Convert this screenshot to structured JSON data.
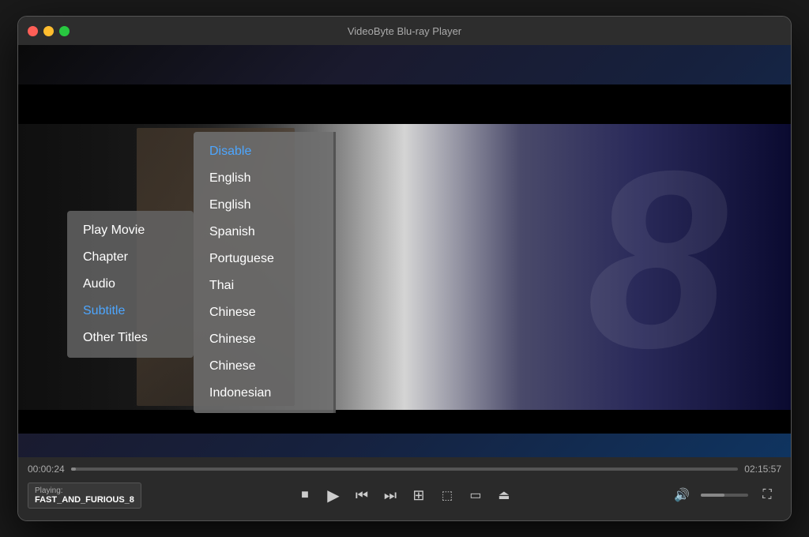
{
  "window": {
    "title": "VideoByte Blu-ray Player"
  },
  "player": {
    "time_current": "00:00:24",
    "time_total": "02:15:57",
    "playing_label": "Playing:",
    "playing_title": "FAST_AND_FURIOUS_8"
  },
  "context_menu": {
    "items": [
      {
        "id": "play-movie",
        "label": "Play Movie",
        "active": false
      },
      {
        "id": "chapter",
        "label": "Chapter",
        "active": false
      },
      {
        "id": "audio",
        "label": "Audio",
        "active": false
      },
      {
        "id": "subtitle",
        "label": "Subtitle",
        "active": true
      },
      {
        "id": "other-titles",
        "label": "Other Titles",
        "active": false
      }
    ]
  },
  "subtitle_menu": {
    "items": [
      {
        "id": "disable",
        "label": "Disable",
        "selected": true
      },
      {
        "id": "english-1",
        "label": "English",
        "selected": false
      },
      {
        "id": "english-2",
        "label": "English",
        "selected": false
      },
      {
        "id": "spanish",
        "label": "Spanish",
        "selected": false
      },
      {
        "id": "portuguese",
        "label": "Portuguese",
        "selected": false
      },
      {
        "id": "thai",
        "label": "Thai",
        "selected": false
      },
      {
        "id": "chinese-1",
        "label": "Chinese",
        "selected": false
      },
      {
        "id": "chinese-2",
        "label": "Chinese",
        "selected": false
      },
      {
        "id": "chinese-3",
        "label": "Chinese",
        "selected": false
      },
      {
        "id": "indonesian",
        "label": "Indonesian",
        "selected": false
      }
    ]
  },
  "controls": {
    "stop": "■",
    "play": "▶",
    "prev": "⏮",
    "next": "⏭",
    "grid": "⊞",
    "camera": "📷",
    "folder": "📁",
    "eject": "⏏",
    "volume": "🔊",
    "fullscreen": "⛶"
  }
}
